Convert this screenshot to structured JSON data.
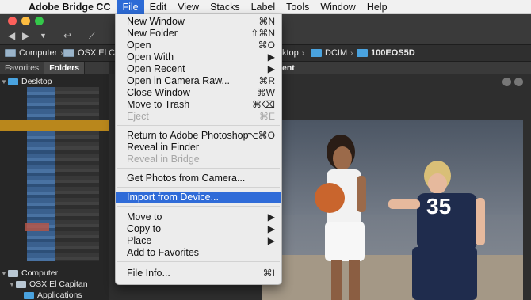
{
  "menubar": {
    "apple_icon": "apple-icon",
    "app_name": "Adobe Bridge CC",
    "menus": [
      "File",
      "Edit",
      "View",
      "Stacks",
      "Label",
      "Tools",
      "Window",
      "Help"
    ],
    "active_menu": "File"
  },
  "pathbar": {
    "computer": "Computer",
    "volume": "OSX El Capitan",
    "partial": "ktop",
    "dcim": "DCIM",
    "folder": "100EOS5D"
  },
  "panel_tabs": [
    "Favorites",
    "Folders"
  ],
  "tree": {
    "desktop": "Desktop",
    "computer": "Computer",
    "volume": "OSX El Capitan",
    "applications": "Applications"
  },
  "content_tab_label": "ent",
  "file_menu": {
    "items": [
      {
        "label": "New Window",
        "shortcut": "⌘N"
      },
      {
        "label": "New Folder",
        "shortcut": "⇧⌘N"
      },
      {
        "label": "Open",
        "shortcut": "⌘O"
      },
      {
        "label": "Open With",
        "shortcut": "▶"
      },
      {
        "label": "Open Recent",
        "shortcut": "▶"
      },
      {
        "label": "Open in Camera Raw...",
        "shortcut": "⌘R"
      },
      {
        "label": "Close Window",
        "shortcut": "⌘W"
      },
      {
        "label": "Move to Trash",
        "shortcut": "⌘⌫"
      },
      {
        "label": "Eject",
        "shortcut": "⌘E"
      },
      {
        "label": "Return to Adobe Photoshop",
        "shortcut": "⌥⌘O"
      },
      {
        "label": "Reveal in Finder",
        "shortcut": ""
      },
      {
        "label": "Reveal in Bridge",
        "shortcut": ""
      },
      {
        "label": "Get Photos from Camera...",
        "shortcut": ""
      },
      {
        "label": "Import from Device...",
        "shortcut": ""
      },
      {
        "label": "Move to",
        "shortcut": "▶"
      },
      {
        "label": "Copy to",
        "shortcut": "▶"
      },
      {
        "label": "Place",
        "shortcut": "▶"
      },
      {
        "label": "Add to Favorites",
        "shortcut": ""
      },
      {
        "label": "File Info...",
        "shortcut": "⌘I"
      }
    ]
  },
  "colors": {
    "menu_highlight": "#2f6bd8",
    "folder_blue": "#4aa3df",
    "selected_row": "#b9871c"
  }
}
